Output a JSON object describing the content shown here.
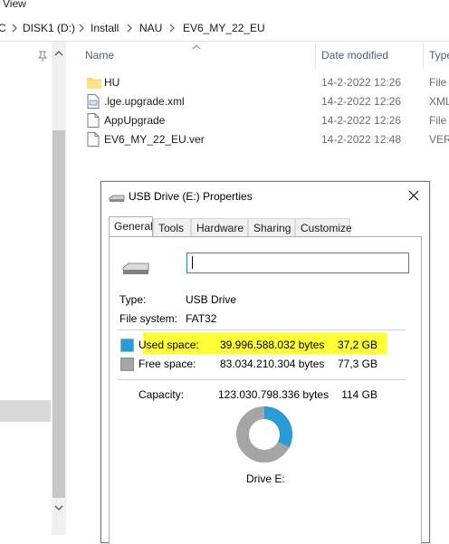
{
  "menu": {
    "view_label": "View"
  },
  "address": {
    "crumbs": [
      "C",
      "DISK1 (D:)",
      "Install",
      "NAU",
      "EV6_MY_22_EU"
    ]
  },
  "columns": {
    "name": "Name",
    "date_modified": "Date modified",
    "type": "Type"
  },
  "files": [
    {
      "name": "HU",
      "date": "14-2-2022 12:26",
      "type": "File",
      "icon": "folder-icon"
    },
    {
      "name": ".lge.upgrade.xml",
      "date": "14-2-2022 12:26",
      "type": "XML",
      "icon": "xml-file-icon"
    },
    {
      "name": "AppUpgrade",
      "date": "14-2-2022 12:26",
      "type": "File",
      "icon": "file-icon"
    },
    {
      "name": "EV6_MY_22_EU.ver",
      "date": "14-2-2022 12:48",
      "type": "VER",
      "icon": "file-icon"
    }
  ],
  "dialog": {
    "title": "USB Drive (E:) Properties",
    "tabs": [
      "General",
      "Tools",
      "Hardware",
      "Sharing",
      "Customize"
    ],
    "active_tab": "General",
    "volume_label_value": "",
    "type_label": "Type:",
    "type_value": "USB Drive",
    "fs_label": "File system:",
    "fs_value": "FAT32",
    "used": {
      "label": "Used space:",
      "bytes": "39.996.588.032 bytes",
      "size": "37,2 GB"
    },
    "free": {
      "label": "Free space:",
      "bytes": "83.034.210.304 bytes",
      "size": "77,3 GB"
    },
    "capacity": {
      "label": "Capacity:",
      "bytes": "123.030.798.336 bytes",
      "size": "114 GB"
    },
    "used_fraction": 0.325,
    "drive_label": "Drive E:"
  },
  "colors": {
    "used": "#2b9bd8",
    "free": "#a5a5a5",
    "highlight": "#ffff38"
  }
}
